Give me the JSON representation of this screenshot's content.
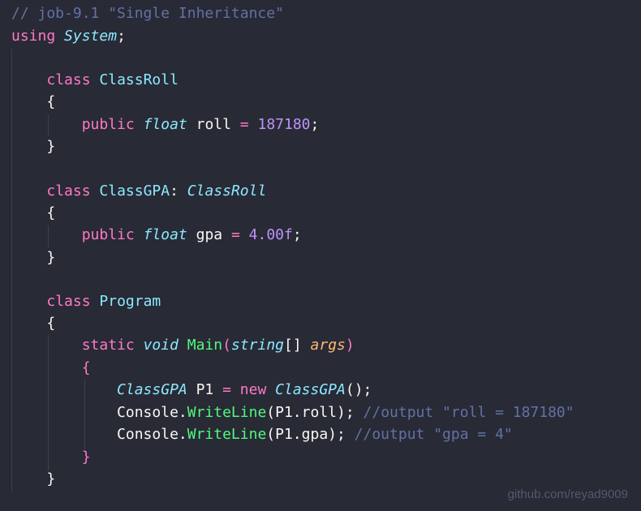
{
  "lines": [
    [
      {
        "t": "// job-9.1 \"Single Inheritance\"",
        "c": "comment"
      }
    ],
    [
      {
        "t": "using",
        "c": "keyword"
      },
      {
        "t": " ",
        "c": "plain"
      },
      {
        "t": "System",
        "c": "type-i"
      },
      {
        "t": ";",
        "c": "plain"
      }
    ],
    [],
    [
      {
        "t": "    ",
        "c": "plain"
      },
      {
        "t": "class",
        "c": "keyword"
      },
      {
        "t": " ",
        "c": "plain"
      },
      {
        "t": "ClassRoll",
        "c": "type"
      }
    ],
    [
      {
        "t": "    {",
        "c": "plain"
      }
    ],
    [
      {
        "t": "        ",
        "c": "plain"
      },
      {
        "t": "public",
        "c": "keyword"
      },
      {
        "t": " ",
        "c": "plain"
      },
      {
        "t": "float",
        "c": "type-i"
      },
      {
        "t": " roll ",
        "c": "plain"
      },
      {
        "t": "=",
        "c": "keyword"
      },
      {
        "t": " ",
        "c": "plain"
      },
      {
        "t": "187180",
        "c": "num"
      },
      {
        "t": ";",
        "c": "plain"
      }
    ],
    [
      {
        "t": "    }",
        "c": "plain"
      }
    ],
    [],
    [
      {
        "t": "    ",
        "c": "plain"
      },
      {
        "t": "class",
        "c": "keyword"
      },
      {
        "t": " ",
        "c": "plain"
      },
      {
        "t": "ClassGPA",
        "c": "type"
      },
      {
        "t": ": ",
        "c": "plain"
      },
      {
        "t": "ClassRoll",
        "c": "type-i"
      }
    ],
    [
      {
        "t": "    {",
        "c": "plain"
      }
    ],
    [
      {
        "t": "        ",
        "c": "plain"
      },
      {
        "t": "public",
        "c": "keyword"
      },
      {
        "t": " ",
        "c": "plain"
      },
      {
        "t": "float",
        "c": "type-i"
      },
      {
        "t": " gpa ",
        "c": "plain"
      },
      {
        "t": "=",
        "c": "keyword"
      },
      {
        "t": " ",
        "c": "plain"
      },
      {
        "t": "4.00f",
        "c": "num"
      },
      {
        "t": ";",
        "c": "plain"
      }
    ],
    [
      {
        "t": "    }",
        "c": "plain"
      }
    ],
    [],
    [
      {
        "t": "    ",
        "c": "plain"
      },
      {
        "t": "class",
        "c": "keyword"
      },
      {
        "t": " ",
        "c": "plain"
      },
      {
        "t": "Program",
        "c": "type"
      }
    ],
    [
      {
        "t": "    {",
        "c": "plain"
      }
    ],
    [
      {
        "t": "        ",
        "c": "plain"
      },
      {
        "t": "static",
        "c": "keyword"
      },
      {
        "t": " ",
        "c": "plain"
      },
      {
        "t": "void",
        "c": "type-i"
      },
      {
        "t": " ",
        "c": "plain"
      },
      {
        "t": "Main",
        "c": "fn"
      },
      {
        "t": "(",
        "c": "keyword"
      },
      {
        "t": "string",
        "c": "type-i"
      },
      {
        "t": "[] ",
        "c": "plain"
      },
      {
        "t": "args",
        "c": "param"
      },
      {
        "t": ")",
        "c": "keyword"
      }
    ],
    [
      {
        "t": "        ",
        "c": "plain"
      },
      {
        "t": "{",
        "c": "keyword"
      }
    ],
    [
      {
        "t": "            ",
        "c": "plain"
      },
      {
        "t": "ClassGPA",
        "c": "type-i"
      },
      {
        "t": " P1 ",
        "c": "plain"
      },
      {
        "t": "=",
        "c": "keyword"
      },
      {
        "t": " ",
        "c": "plain"
      },
      {
        "t": "new",
        "c": "keyword"
      },
      {
        "t": " ",
        "c": "plain"
      },
      {
        "t": "ClassGPA",
        "c": "type-i"
      },
      {
        "t": "();",
        "c": "plain"
      }
    ],
    [
      {
        "t": "            Console.",
        "c": "plain"
      },
      {
        "t": "WriteLine",
        "c": "fn"
      },
      {
        "t": "(P1.roll); ",
        "c": "plain"
      },
      {
        "t": "//output \"roll = 187180\"",
        "c": "comment"
      }
    ],
    [
      {
        "t": "            Console.",
        "c": "plain"
      },
      {
        "t": "WriteLine",
        "c": "fn"
      },
      {
        "t": "(P1.gpa); ",
        "c": "plain"
      },
      {
        "t": "//output \"gpa = 4\"",
        "c": "comment"
      }
    ],
    [
      {
        "t": "        ",
        "c": "plain"
      },
      {
        "t": "}",
        "c": "keyword"
      }
    ],
    [
      {
        "t": "    }",
        "c": "plain"
      }
    ]
  ],
  "watermark": "github.com/reyad9009",
  "colors": {
    "background": "#282a36",
    "comment": "#6272a4",
    "keyword": "#ff79c6",
    "type": "#8be9fd",
    "number": "#bd93f9",
    "function": "#50fa7b",
    "parameter": "#ffb86c",
    "plain": "#f8f8f2"
  }
}
